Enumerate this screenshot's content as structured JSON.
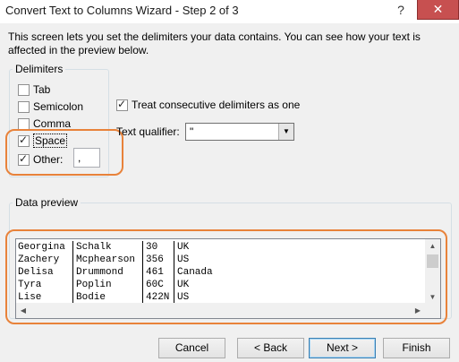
{
  "window": {
    "title": "Convert Text to Columns Wizard - Step 2 of 3",
    "help_label": "?",
    "close_label": "✕"
  },
  "description": "This screen lets you set the delimiters your data contains.  You can see how your text is affected in the preview below.",
  "delimiters": {
    "legend": "Delimiters",
    "options": [
      {
        "name": "Tab",
        "checked": false
      },
      {
        "name": "Semicolon",
        "checked": false
      },
      {
        "name": "Comma",
        "checked": false
      },
      {
        "name": "Space",
        "checked": true
      },
      {
        "name": "Other:",
        "checked": true
      }
    ],
    "other_value": ","
  },
  "consecutive": {
    "label": "Treat consecutive delimiters as one",
    "checked": true
  },
  "qualifier": {
    "label": "Text qualifier:",
    "value": "\""
  },
  "preview": {
    "legend": "Data preview",
    "rows": [
      [
        "Georgina",
        "Schalk",
        "30",
        "UK"
      ],
      [
        "Zachery",
        "Mcphearson",
        "356",
        "US"
      ],
      [
        "Delisa",
        "Drummond",
        "461",
        "Canada"
      ],
      [
        "Tyra",
        "Poplin",
        "60C",
        "UK"
      ],
      [
        "Lise",
        "Bodie",
        "422N",
        "US"
      ]
    ]
  },
  "buttons": {
    "cancel": "Cancel",
    "back": "< Back",
    "next": "Next >",
    "finish": "Finish"
  },
  "colors": {
    "highlight": "#e8823a",
    "close": "#c75050"
  }
}
